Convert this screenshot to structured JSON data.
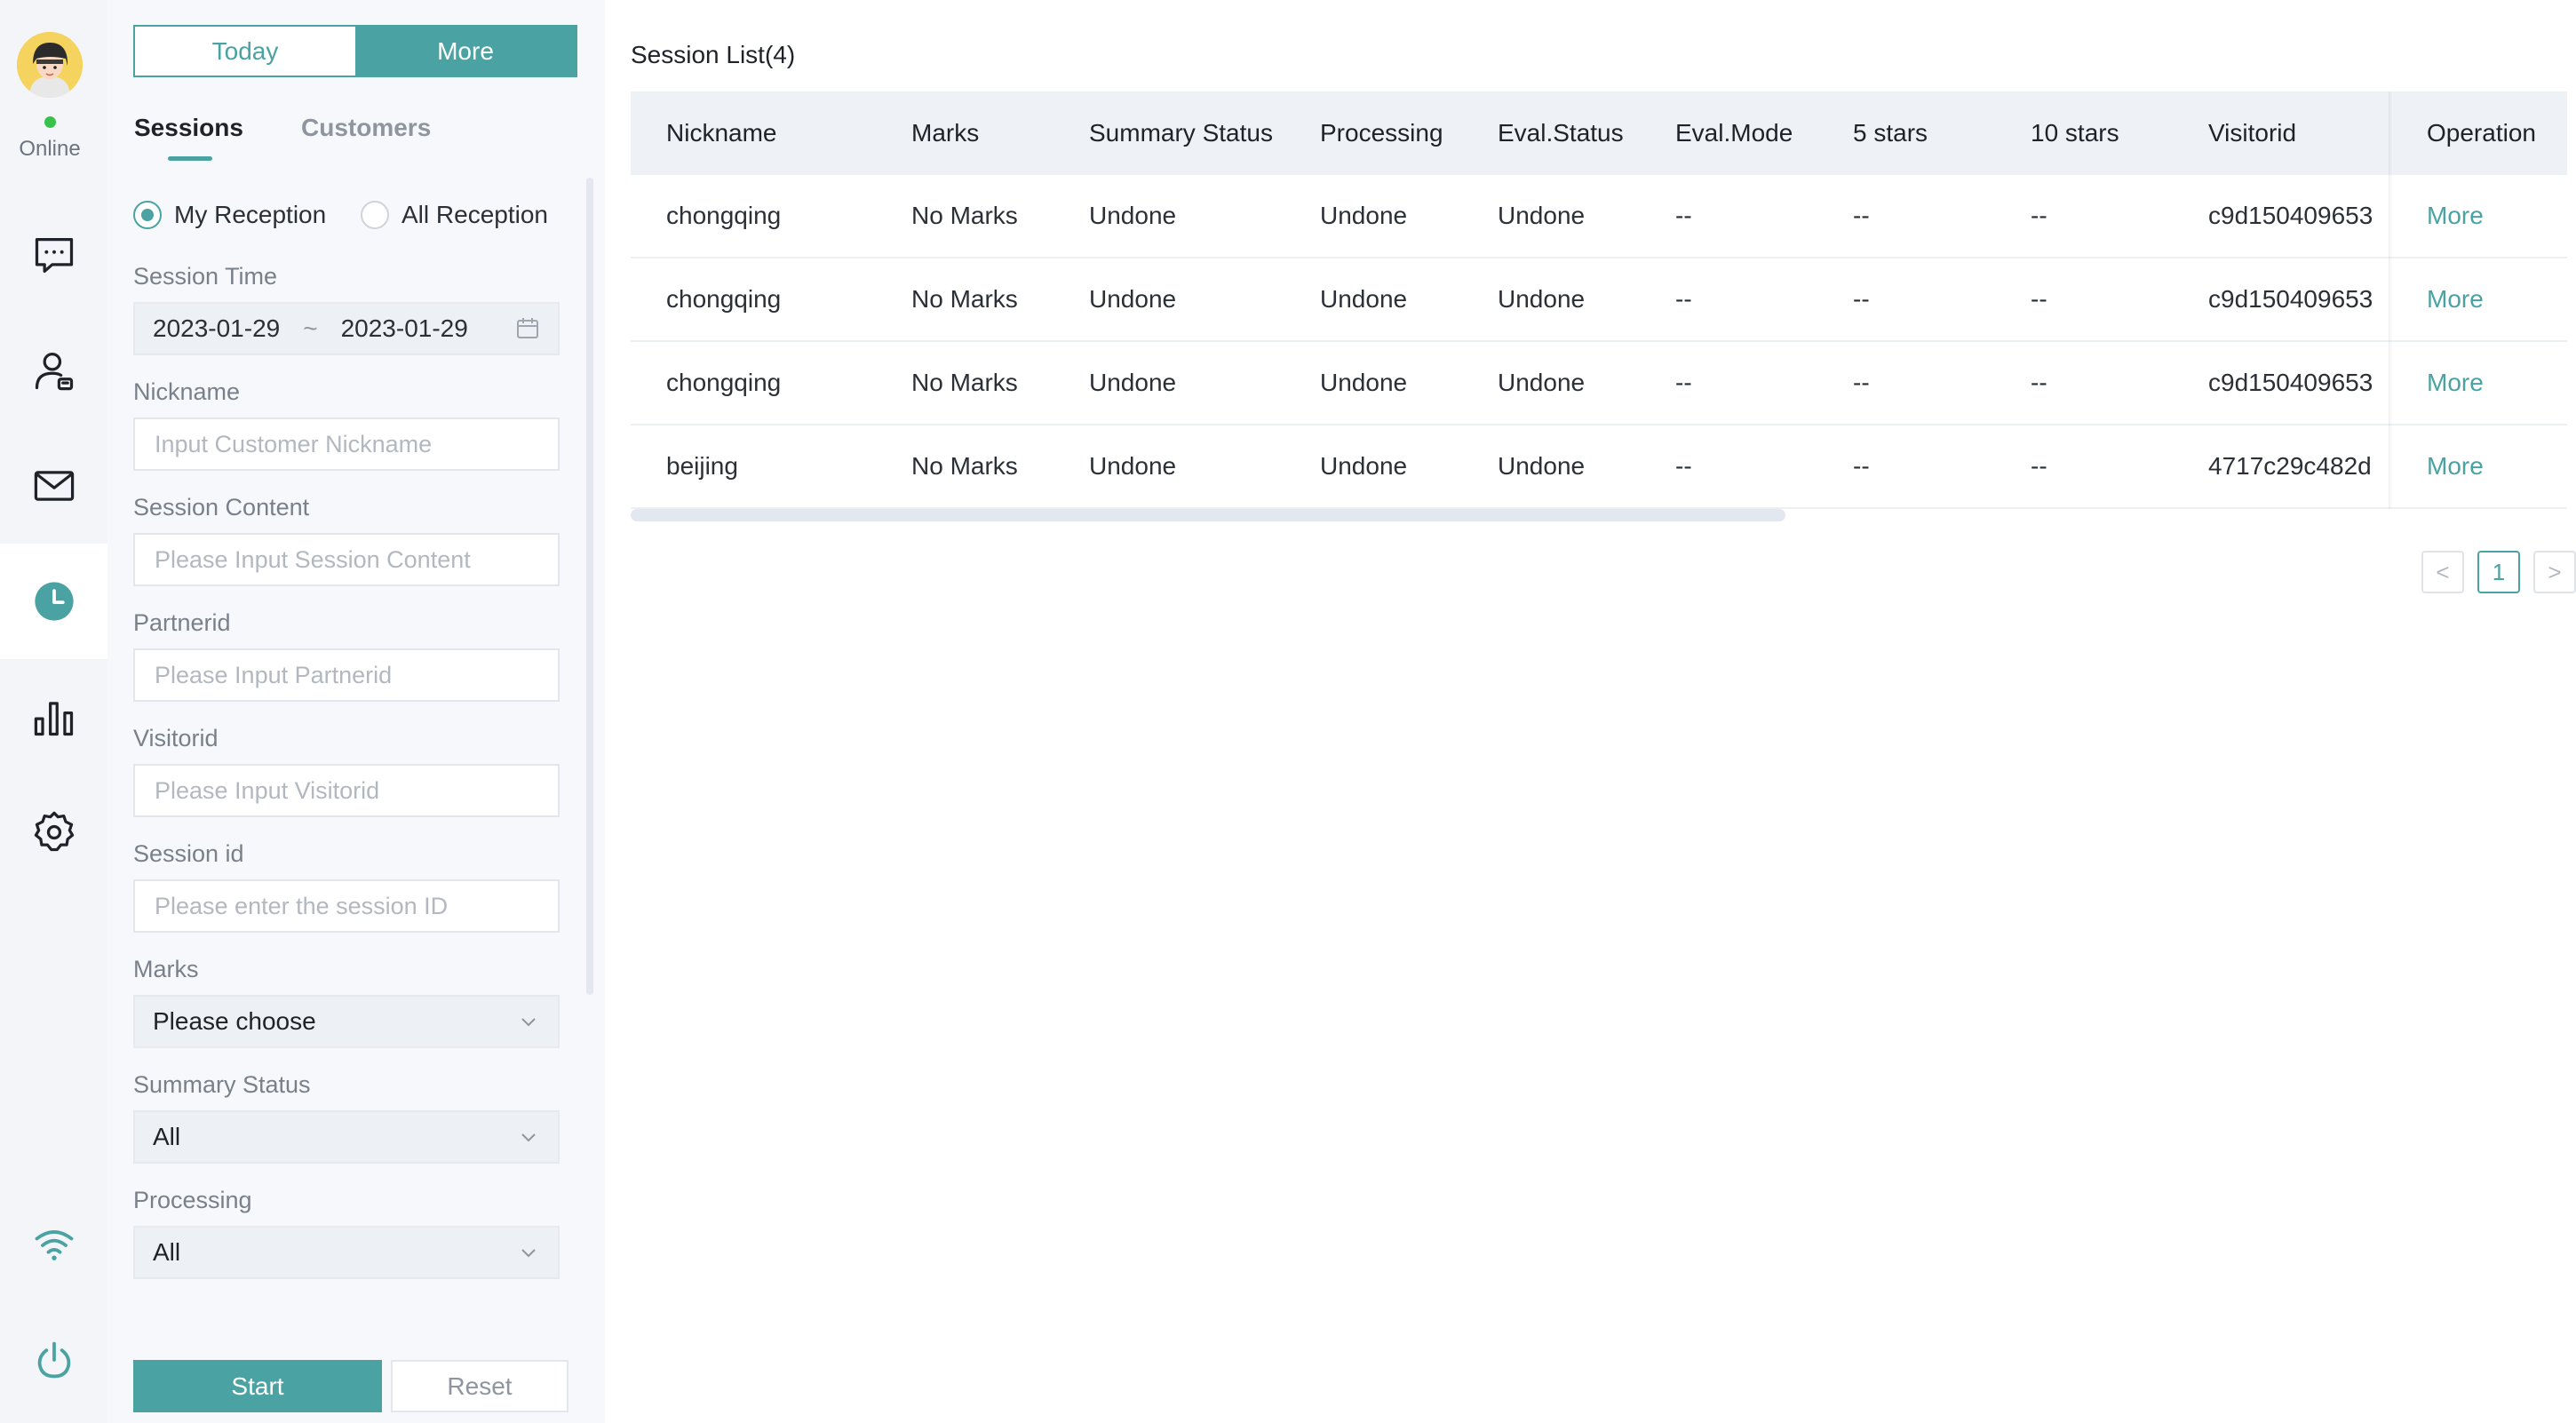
{
  "status": {
    "online_label": "Online"
  },
  "rail": {
    "items": [
      {
        "name": "chat-icon"
      },
      {
        "name": "customer-service-icon"
      },
      {
        "name": "mail-icon"
      },
      {
        "name": "history-clock-icon",
        "active": true
      },
      {
        "name": "stats-chart-icon"
      },
      {
        "name": "settings-gear-icon"
      }
    ],
    "bottom": [
      {
        "name": "wifi-icon"
      },
      {
        "name": "power-icon"
      }
    ]
  },
  "colors": {
    "accent": "#4aa3a2",
    "online": "#36c24b"
  },
  "panel": {
    "segment": {
      "today": "Today",
      "more": "More",
      "selected": "More"
    },
    "tabs": {
      "sessions": "Sessions",
      "customers": "Customers",
      "active": "Sessions"
    },
    "reception": {
      "mine": "My Reception",
      "all": "All Reception",
      "selected": "My Reception"
    },
    "session_time": {
      "label": "Session Time",
      "start": "2023-01-29",
      "separator": "~",
      "end": "2023-01-29"
    },
    "nickname": {
      "label": "Nickname",
      "placeholder": "Input Customer Nickname",
      "value": ""
    },
    "session_content": {
      "label": "Session Content",
      "placeholder": "Please Input Session Content",
      "value": ""
    },
    "partnerid": {
      "label": "Partnerid",
      "placeholder": "Please Input Partnerid",
      "value": ""
    },
    "visitorid": {
      "label": "Visitorid",
      "placeholder": "Please Input Visitorid",
      "value": ""
    },
    "session_id": {
      "label": "Session id",
      "placeholder": "Please enter the session ID",
      "value": ""
    },
    "marks": {
      "label": "Marks",
      "value": "Please choose"
    },
    "summary_status": {
      "label": "Summary Status",
      "value": "All"
    },
    "processing": {
      "label": "Processing",
      "value": "All"
    },
    "start_button": "Start",
    "reset_button": "Reset"
  },
  "main": {
    "title": "Session List(4)",
    "columns": [
      "Nickname",
      "Marks",
      "Summary Status",
      "Processing",
      "Eval.Status",
      "Eval.Mode",
      "5 stars",
      "10 stars",
      "Visitorid",
      "Operation"
    ],
    "rows": [
      [
        "chongqing",
        "No Marks",
        "Undone",
        "Undone",
        "Undone",
        "--",
        "--",
        "--",
        "c9d150409653",
        "More"
      ],
      [
        "chongqing",
        "No Marks",
        "Undone",
        "Undone",
        "Undone",
        "--",
        "--",
        "--",
        "c9d150409653",
        "More"
      ],
      [
        "chongqing",
        "No Marks",
        "Undone",
        "Undone",
        "Undone",
        "--",
        "--",
        "--",
        "c9d150409653",
        "More"
      ],
      [
        "beijing",
        "No Marks",
        "Undone",
        "Undone",
        "Undone",
        "--",
        "--",
        "--",
        "4717c29c482d",
        "More"
      ]
    ],
    "pagination": {
      "prev": "<",
      "current": "1",
      "next": ">"
    }
  }
}
